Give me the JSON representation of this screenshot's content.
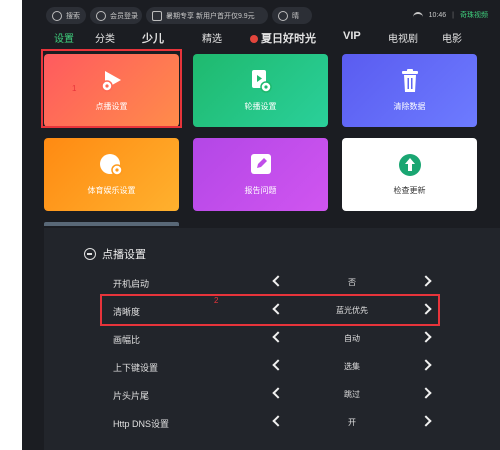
{
  "status": {
    "search": "搜索",
    "member": "会员登录",
    "promo": "暑期专享 新用户首开仅9.9元",
    "weather": "晴",
    "time": "10:46",
    "brand": "奇珠视频"
  },
  "nav": {
    "tabs": [
      "设置",
      "分类",
      "少儿",
      "精选",
      "夏日好时光",
      "VIP",
      "电视剧",
      "电影"
    ]
  },
  "tiles": [
    {
      "label": "点播设置",
      "icon": "play-gear-icon"
    },
    {
      "label": "轮播设置",
      "icon": "carousel-gear-icon"
    },
    {
      "label": "清除数据",
      "icon": "trash-icon"
    },
    {
      "label": "体育娱乐设置",
      "icon": "sports-gear-icon"
    },
    {
      "label": "报告问题",
      "icon": "edit-report-icon"
    },
    {
      "label": "检查更新",
      "icon": "upload-arrow-icon"
    }
  ],
  "annotations": {
    "mark1": "1",
    "mark2": "2"
  },
  "panel": {
    "title": "点播设置",
    "rows": [
      {
        "label": "开机启动",
        "value": "否"
      },
      {
        "label": "清晰度",
        "value": "蓝光优先"
      },
      {
        "label": "画幅比",
        "value": "自动"
      },
      {
        "label": "上下键设置",
        "value": "选集"
      },
      {
        "label": "片头片尾",
        "value": "跳过"
      },
      {
        "label": "Http DNS设置",
        "value": "开"
      }
    ]
  },
  "colors": {
    "accent": "#3fd07d",
    "highlight": "#e8343b",
    "background": "#1b1d22"
  }
}
